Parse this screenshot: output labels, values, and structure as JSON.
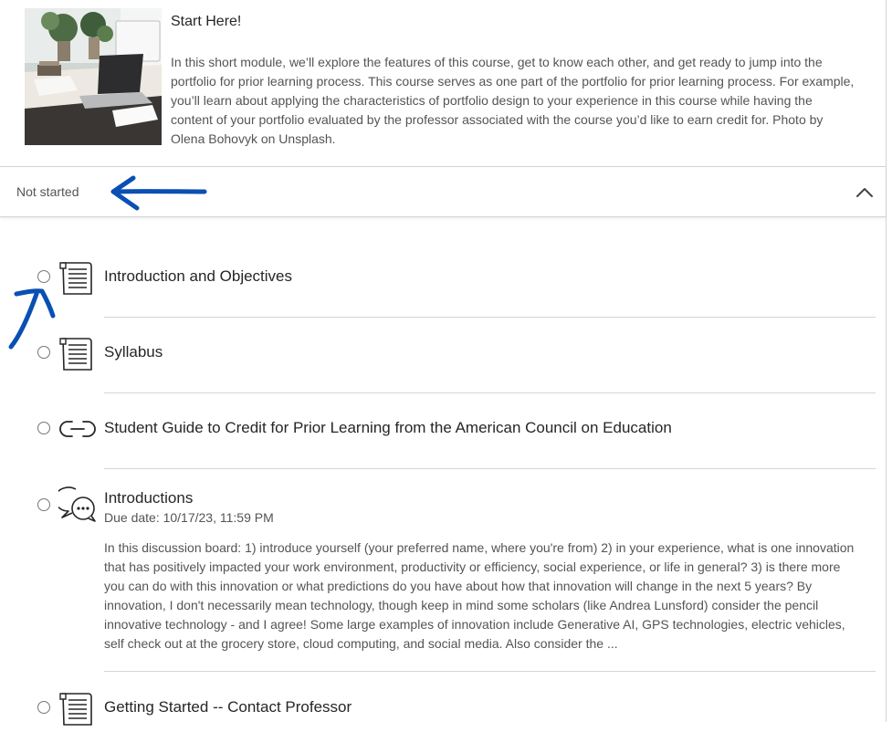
{
  "module": {
    "title": "Start Here!",
    "description": "In this short module, we’ll explore the features of this course, get to know each other, and get ready to jump into the portfolio for prior learning process. This course serves as one part of the portfolio for prior learning process. For example, you’ll learn about applying the characteristics of portfolio design to your experience in this course while having the content of your portfolio evaluated by the professor associated with the course you’d like to earn credit for. Photo by Olena Bohovyk on Unsplash.",
    "image_icon": "desk-photo"
  },
  "status": {
    "label": "Not started",
    "collapse_icon": "chevron-up-icon"
  },
  "items": [
    {
      "icon": "document-icon",
      "title": "Introduction and Objectives"
    },
    {
      "icon": "document-icon",
      "title": "Syllabus"
    },
    {
      "icon": "link-icon",
      "title": "Student Guide to Credit for Prior Learning from the American Council on Education"
    },
    {
      "icon": "discussion-icon",
      "title": "Introductions",
      "due": "Due date: 10/17/23, 11:59 PM",
      "description": "In this discussion board: 1) introduce yourself (your preferred name, where you're from) 2) in your experience, what is one innovation that has positively impacted your work environment, productivity or efficiency, social experience, or life in general? 3) is there more you can do with this innovation or what predictions do you have about how that innovation will change in the next 5 years? By innovation, I don't necessarily mean technology, though keep in mind some scholars (like Andrea Lunsford) consider the pencil innovative technology - and I agree! Some large examples of innovation include Generative AI, GPS technologies, electric vehicles, self check out at the grocery store, cloud computing, and social media. Also consider the ..."
    },
    {
      "icon": "document-icon",
      "title": "Getting Started -- Contact Professor"
    }
  ],
  "colors": {
    "annotation_blue": "#0a4fb3",
    "divider": "#d4d4d4",
    "text_primary": "#262626",
    "text_secondary": "#545454"
  }
}
